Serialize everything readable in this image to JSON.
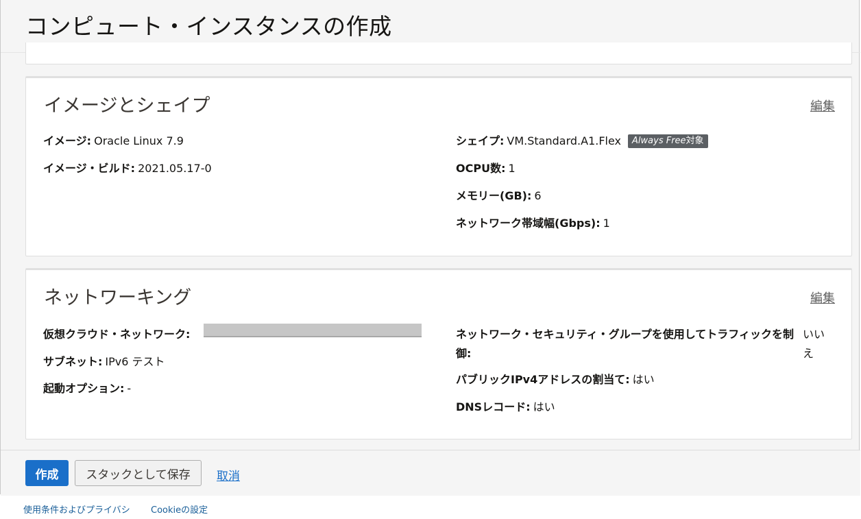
{
  "page": {
    "title": "コンピュート・インスタンスの作成"
  },
  "image_shape": {
    "title": "イメージとシェイプ",
    "edit_label": "編集",
    "image_label": "イメージ:",
    "image_value": "Oracle Linux 7.9",
    "build_label": "イメージ・ビルド:",
    "build_value": "2021.05.17-0",
    "shape_label": "シェイプ:",
    "shape_value": "VM.Standard.A1.Flex",
    "badge_italic": "Always Free",
    "badge_suffix": "対象",
    "ocpu_label": "OCPU数:",
    "ocpu_value": "1",
    "memory_label": "メモリー(GB):",
    "memory_value": "6",
    "bandwidth_label": "ネットワーク帯域幅(Gbps):",
    "bandwidth_value": "1"
  },
  "networking": {
    "title": "ネットワーキング",
    "edit_label": "編集",
    "vcn_label": "仮想クラウド・ネットワーク:",
    "subnet_label": "サブネット:",
    "subnet_value": "IPv6 テスト",
    "boot_label": "起動オプション:",
    "boot_value": "-",
    "nsg_label": "ネットワーク・セキュリティ・グループを使用してトラフィックを制御:",
    "nsg_value": "いいえ",
    "public_ip_label": "パブリックIPv4アドレスの割当て:",
    "public_ip_value": "はい",
    "dns_label": "DNSレコード:",
    "dns_value": "はい"
  },
  "actions": {
    "create": "作成",
    "save_stack": "スタックとして保存",
    "cancel": "取消"
  },
  "footer": {
    "terms": "使用条件およびプライバシ",
    "cookie": "Cookieの設定"
  }
}
